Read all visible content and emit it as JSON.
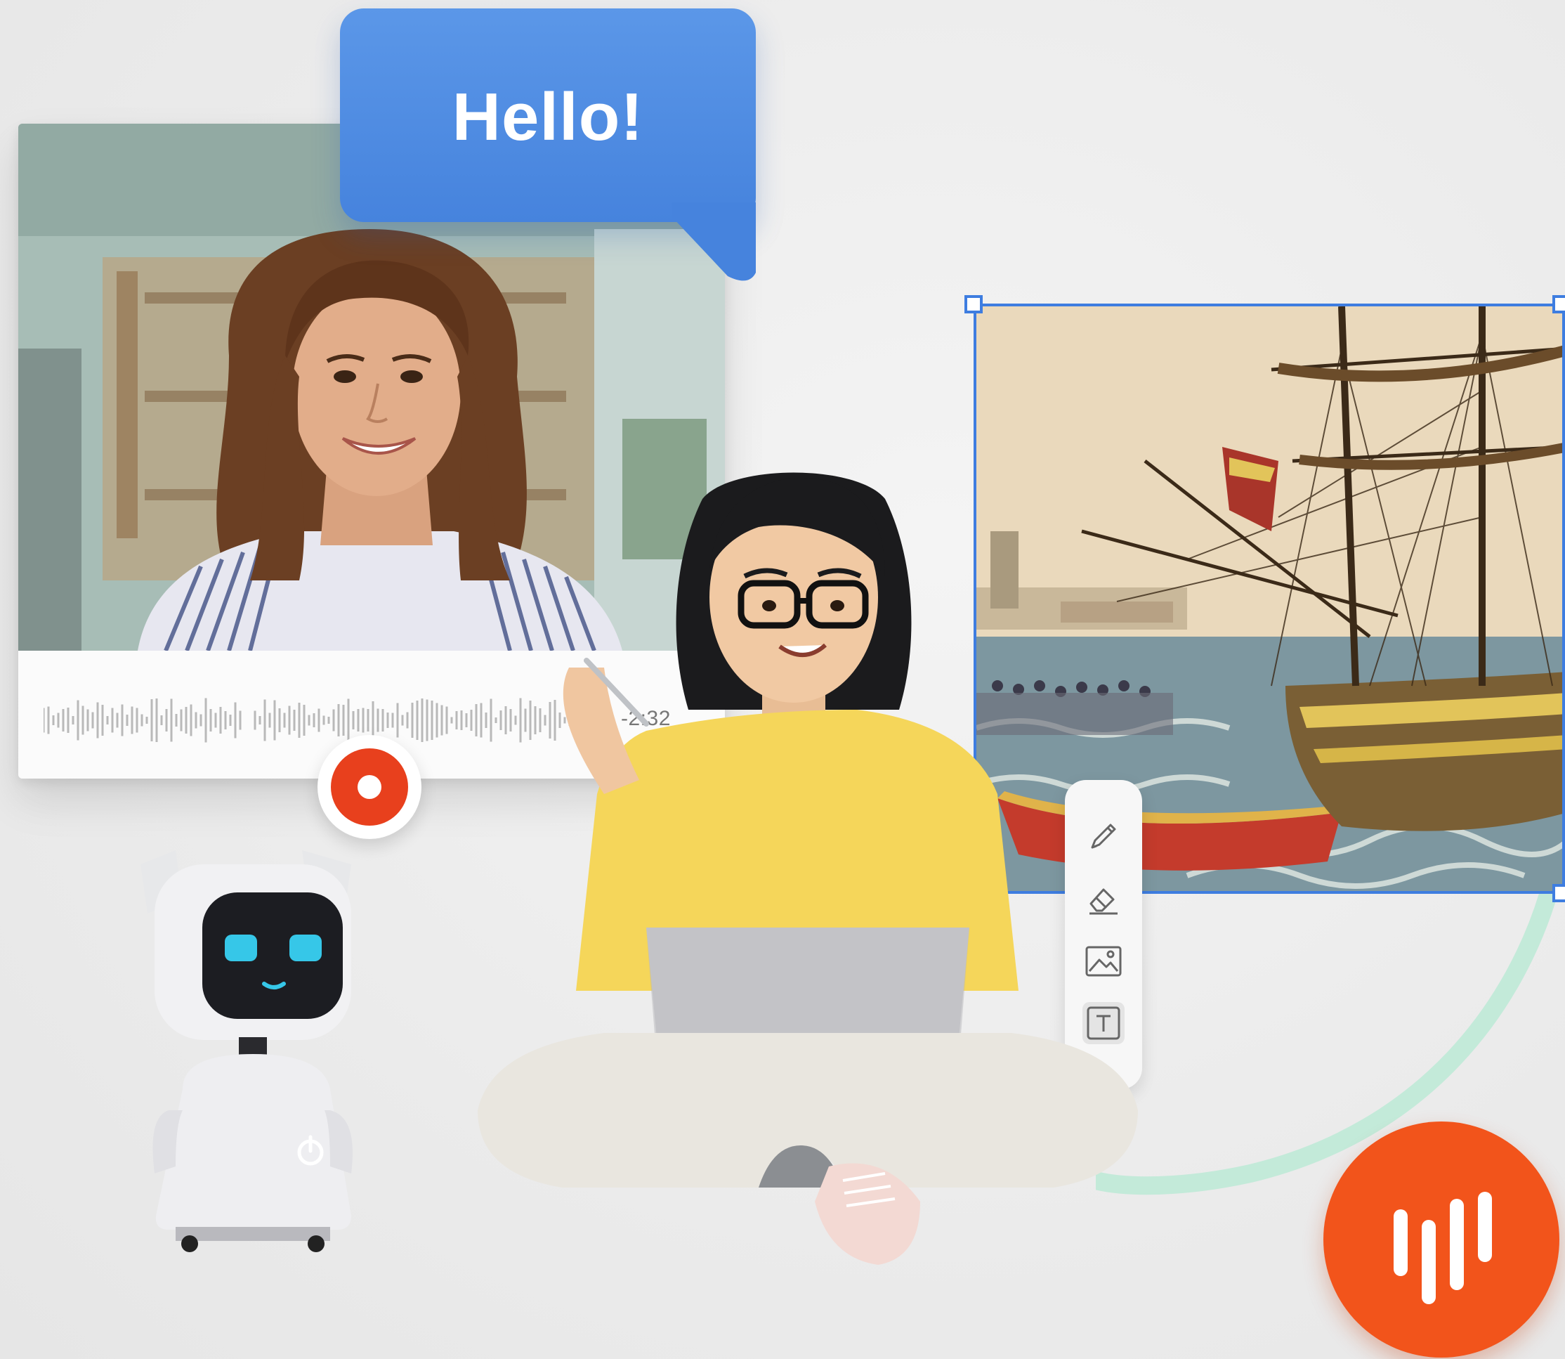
{
  "speech_bubble": {
    "text": "Hello!"
  },
  "video_player": {
    "time_remaining": "-2:32"
  },
  "toolbar": {
    "tools": [
      "pencil-icon",
      "eraser-icon",
      "image-icon",
      "text-icon"
    ]
  },
  "colors": {
    "accent_blue": "#4683dd",
    "selection_blue": "#3e7de0",
    "record_red": "#e8401d",
    "audio_orange": "#f2541b",
    "connector_mint": "#bfe8d6"
  }
}
